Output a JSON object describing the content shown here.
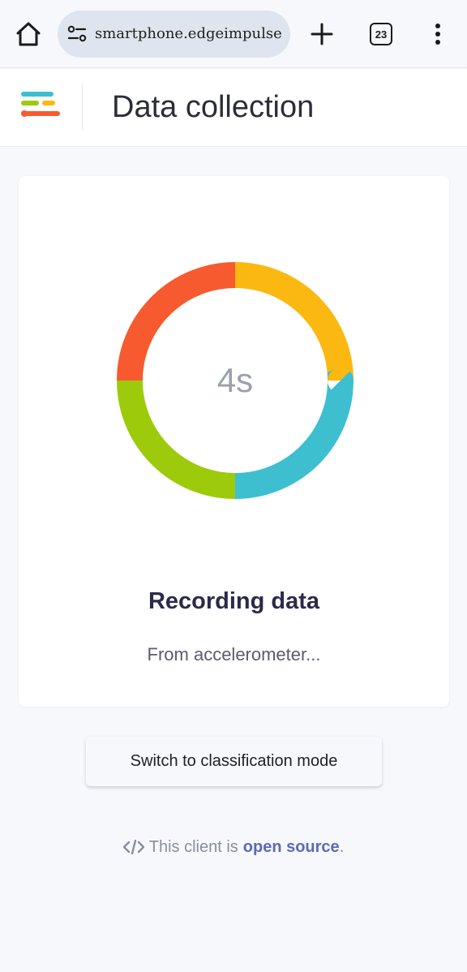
{
  "browser": {
    "url": "smartphone.edgeimpulse.com/i",
    "tab_count": "23"
  },
  "header": {
    "title": "Data collection"
  },
  "recorder": {
    "countdown": "4s",
    "status_title": "Recording data",
    "status_subtitle": "From accelerometer...",
    "ring_colors": [
      "#f85a30",
      "#fbb810",
      "#3dbfd0",
      "#9dcb0c"
    ]
  },
  "actions": {
    "switch_label": "Switch to classification mode"
  },
  "footer": {
    "prefix": "This client is",
    "link": "open source",
    "suffix": "."
  },
  "colors": {
    "accent_link": "#5a6ab8",
    "title_text": "#2c2a4a"
  }
}
